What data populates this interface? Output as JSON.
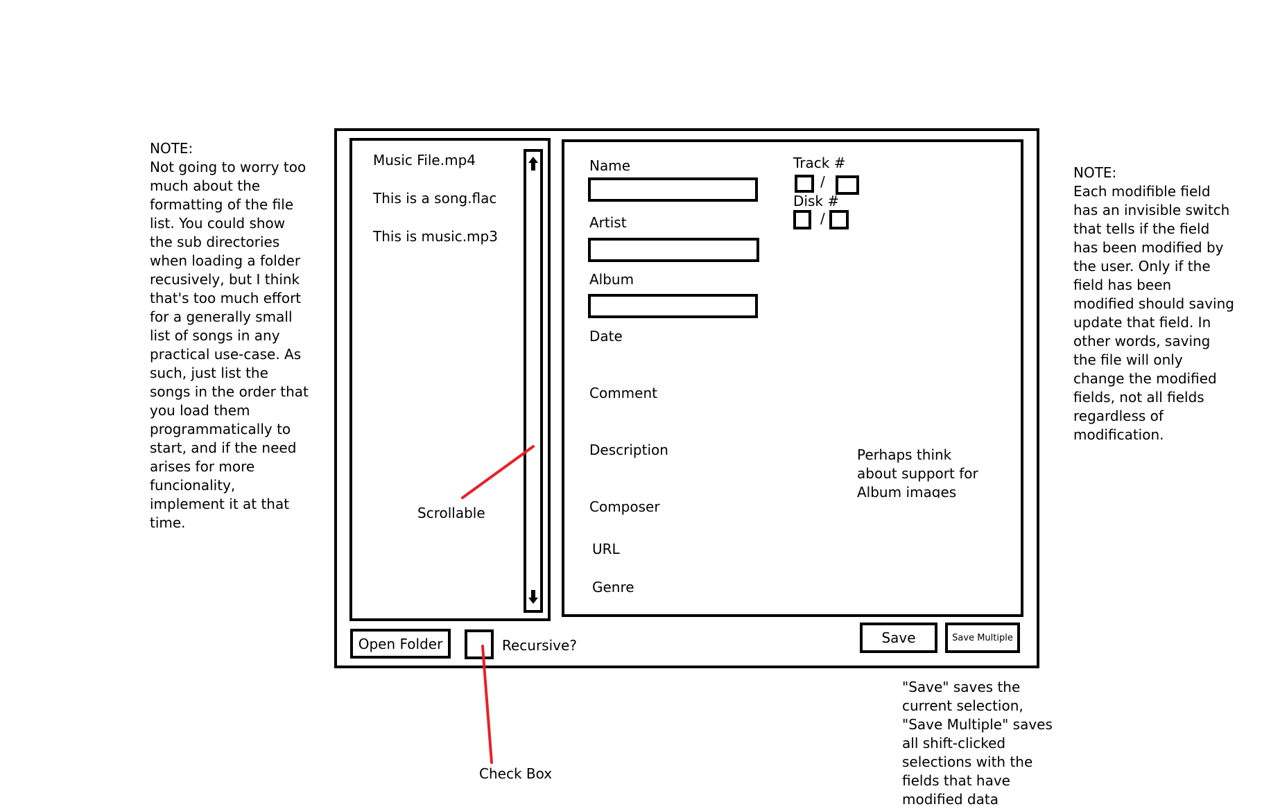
{
  "left_note": {
    "heading": "NOTE:",
    "text": "Not going to worry too much about the formatting of the file list. You could show the sub directories when loading a folder recusively, but I think that's too much effort for a generally small list of songs in any practical use-case. As such, just list the songs in the order that you load them programmatically to start, and if the need arises for more funcionality, implement it at that time."
  },
  "right_note": {
    "heading": "NOTE:",
    "text": "Each modifible field has an invisible switch that tells if the field has been modified by the user. Only if the field has been modified should saving update that field. In other words, saving the file will only change the modified fields, not all fields regardless of modification."
  },
  "file_list": {
    "items": [
      "Music File.mp4",
      "This is a song.flac",
      "This is music.mp3"
    ],
    "scroll_up_icon": "arrow-up-icon",
    "scroll_down_icon": "arrow-down-icon"
  },
  "annotations": {
    "scrollable": "Scrollable",
    "check_box": "Check Box",
    "album_images": "Perhaps think about support for Album images",
    "save_explanation": "\"Save\" saves the current selection, \"Save Multiple\" saves all shift-clicked selections with the fields that have modified data",
    "arrow_color": "#e8202a"
  },
  "fields": {
    "name": "Name",
    "artist": "Artist",
    "album": "Album",
    "date": "Date",
    "comment": "Comment",
    "description": "Description",
    "composer": "Composer",
    "url": "URL",
    "genre": "Genre",
    "track": "Track #",
    "disk": "Disk #",
    "separator": "/"
  },
  "bottom": {
    "open_folder": "Open Folder",
    "recursive": "Recursive?",
    "save": "Save",
    "save_multiple": "Save Multiple"
  }
}
